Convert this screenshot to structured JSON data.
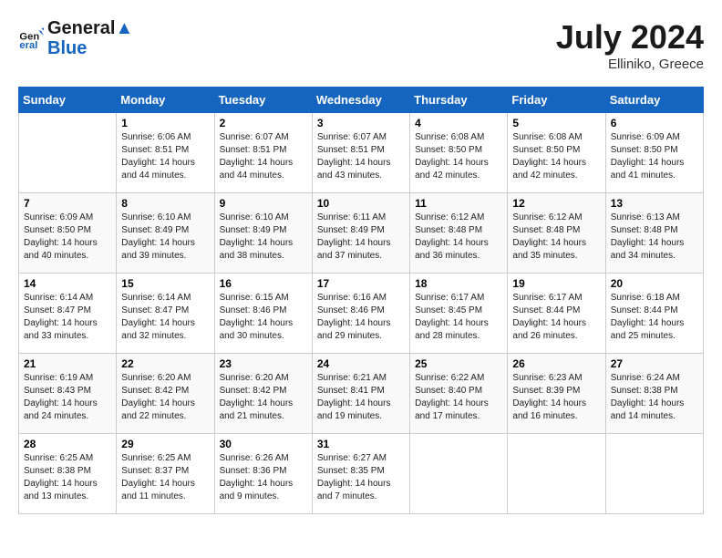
{
  "logo": {
    "line1": "General",
    "line2": "Blue"
  },
  "title": "July 2024",
  "location": "Elliniko, Greece",
  "days_of_week": [
    "Sunday",
    "Monday",
    "Tuesday",
    "Wednesday",
    "Thursday",
    "Friday",
    "Saturday"
  ],
  "weeks": [
    [
      null,
      {
        "day": 1,
        "sunrise": "6:06 AM",
        "sunset": "8:51 PM",
        "daylight": "14 hours and 44 minutes."
      },
      {
        "day": 2,
        "sunrise": "6:07 AM",
        "sunset": "8:51 PM",
        "daylight": "14 hours and 44 minutes."
      },
      {
        "day": 3,
        "sunrise": "6:07 AM",
        "sunset": "8:51 PM",
        "daylight": "14 hours and 43 minutes."
      },
      {
        "day": 4,
        "sunrise": "6:08 AM",
        "sunset": "8:50 PM",
        "daylight": "14 hours and 42 minutes."
      },
      {
        "day": 5,
        "sunrise": "6:08 AM",
        "sunset": "8:50 PM",
        "daylight": "14 hours and 42 minutes."
      },
      {
        "day": 6,
        "sunrise": "6:09 AM",
        "sunset": "8:50 PM",
        "daylight": "14 hours and 41 minutes."
      }
    ],
    [
      {
        "day": 7,
        "sunrise": "6:09 AM",
        "sunset": "8:50 PM",
        "daylight": "14 hours and 40 minutes."
      },
      {
        "day": 8,
        "sunrise": "6:10 AM",
        "sunset": "8:49 PM",
        "daylight": "14 hours and 39 minutes."
      },
      {
        "day": 9,
        "sunrise": "6:10 AM",
        "sunset": "8:49 PM",
        "daylight": "14 hours and 38 minutes."
      },
      {
        "day": 10,
        "sunrise": "6:11 AM",
        "sunset": "8:49 PM",
        "daylight": "14 hours and 37 minutes."
      },
      {
        "day": 11,
        "sunrise": "6:12 AM",
        "sunset": "8:48 PM",
        "daylight": "14 hours and 36 minutes."
      },
      {
        "day": 12,
        "sunrise": "6:12 AM",
        "sunset": "8:48 PM",
        "daylight": "14 hours and 35 minutes."
      },
      {
        "day": 13,
        "sunrise": "6:13 AM",
        "sunset": "8:48 PM",
        "daylight": "14 hours and 34 minutes."
      }
    ],
    [
      {
        "day": 14,
        "sunrise": "6:14 AM",
        "sunset": "8:47 PM",
        "daylight": "14 hours and 33 minutes."
      },
      {
        "day": 15,
        "sunrise": "6:14 AM",
        "sunset": "8:47 PM",
        "daylight": "14 hours and 32 minutes."
      },
      {
        "day": 16,
        "sunrise": "6:15 AM",
        "sunset": "8:46 PM",
        "daylight": "14 hours and 30 minutes."
      },
      {
        "day": 17,
        "sunrise": "6:16 AM",
        "sunset": "8:46 PM",
        "daylight": "14 hours and 29 minutes."
      },
      {
        "day": 18,
        "sunrise": "6:17 AM",
        "sunset": "8:45 PM",
        "daylight": "14 hours and 28 minutes."
      },
      {
        "day": 19,
        "sunrise": "6:17 AM",
        "sunset": "8:44 PM",
        "daylight": "14 hours and 26 minutes."
      },
      {
        "day": 20,
        "sunrise": "6:18 AM",
        "sunset": "8:44 PM",
        "daylight": "14 hours and 25 minutes."
      }
    ],
    [
      {
        "day": 21,
        "sunrise": "6:19 AM",
        "sunset": "8:43 PM",
        "daylight": "14 hours and 24 minutes."
      },
      {
        "day": 22,
        "sunrise": "6:20 AM",
        "sunset": "8:42 PM",
        "daylight": "14 hours and 22 minutes."
      },
      {
        "day": 23,
        "sunrise": "6:20 AM",
        "sunset": "8:42 PM",
        "daylight": "14 hours and 21 minutes."
      },
      {
        "day": 24,
        "sunrise": "6:21 AM",
        "sunset": "8:41 PM",
        "daylight": "14 hours and 19 minutes."
      },
      {
        "day": 25,
        "sunrise": "6:22 AM",
        "sunset": "8:40 PM",
        "daylight": "14 hours and 17 minutes."
      },
      {
        "day": 26,
        "sunrise": "6:23 AM",
        "sunset": "8:39 PM",
        "daylight": "14 hours and 16 minutes."
      },
      {
        "day": 27,
        "sunrise": "6:24 AM",
        "sunset": "8:38 PM",
        "daylight": "14 hours and 14 minutes."
      }
    ],
    [
      {
        "day": 28,
        "sunrise": "6:25 AM",
        "sunset": "8:38 PM",
        "daylight": "14 hours and 13 minutes."
      },
      {
        "day": 29,
        "sunrise": "6:25 AM",
        "sunset": "8:37 PM",
        "daylight": "14 hours and 11 minutes."
      },
      {
        "day": 30,
        "sunrise": "6:26 AM",
        "sunset": "8:36 PM",
        "daylight": "14 hours and 9 minutes."
      },
      {
        "day": 31,
        "sunrise": "6:27 AM",
        "sunset": "8:35 PM",
        "daylight": "14 hours and 7 minutes."
      },
      null,
      null,
      null
    ]
  ]
}
